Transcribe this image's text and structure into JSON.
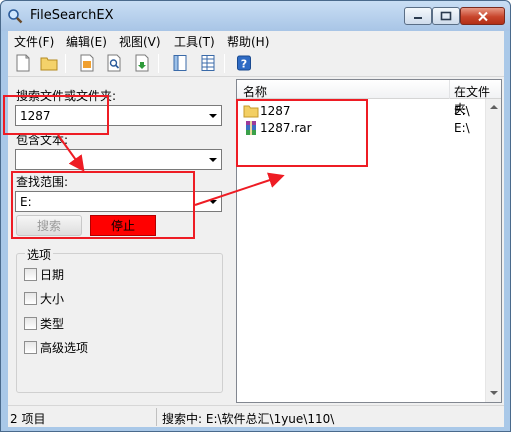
{
  "window": {
    "title": "FileSearchEX"
  },
  "menu": [
    {
      "label": "文件(F)"
    },
    {
      "label": "编辑(E)"
    },
    {
      "label": "视图(V)"
    },
    {
      "label": "工具(T)"
    },
    {
      "label": "帮助(H)"
    }
  ],
  "toolbar": {
    "icons": [
      "new-file-icon",
      "open-folder-icon",
      "document-icon",
      "preview-icon",
      "export-icon",
      "panel-icon",
      "grid-view-icon",
      "help-icon"
    ]
  },
  "search": {
    "name_label": "搜索文件或文件夹:",
    "name_value": "1287",
    "contains_label": "包含文本:",
    "contains_value": "",
    "scope_label": "查找范围:",
    "scope_value": "E:",
    "search_button": "搜索",
    "stop_button": "停止"
  },
  "options": {
    "title": "选项",
    "items": [
      {
        "label": "日期",
        "checked": false
      },
      {
        "label": "大小",
        "checked": false
      },
      {
        "label": "类型",
        "checked": false
      },
      {
        "label": "高级选项",
        "checked": false
      }
    ]
  },
  "results": {
    "columns": [
      "名称",
      "在文件夹"
    ],
    "rows": [
      {
        "name": "1287",
        "folder": "E:\\",
        "icon": "folder-icon"
      },
      {
        "name": "1287.rar",
        "folder": "E:\\",
        "icon": "rar-archive-icon"
      }
    ]
  },
  "status": {
    "count": "2 项目",
    "progress": "搜索中:  E:\\软件总汇\\1yue\\110\\"
  },
  "colors": {
    "annotation": "#ee1c24",
    "stop_button": "#ff0000",
    "title_gradient_top": "#c9def4"
  }
}
